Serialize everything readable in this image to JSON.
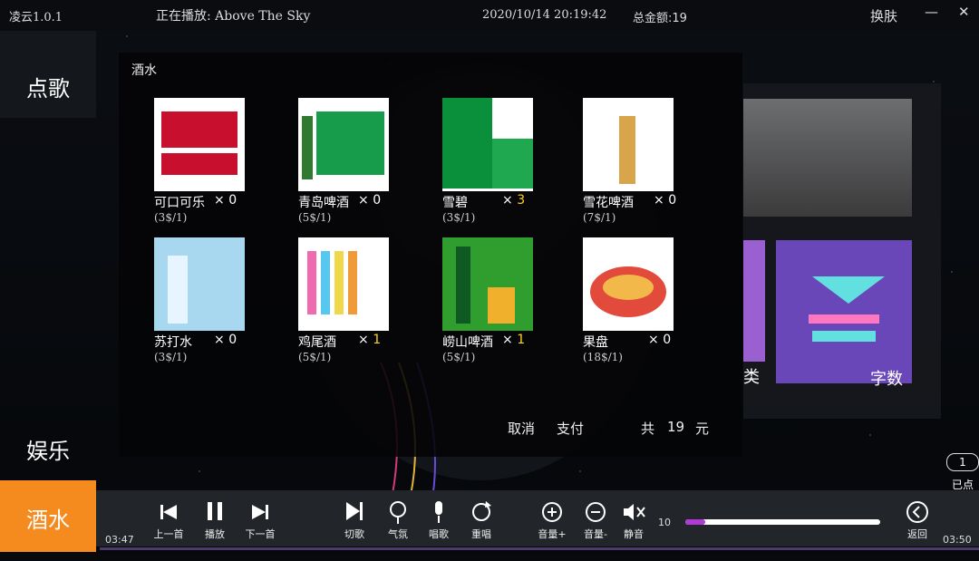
{
  "app": {
    "title": "凌云1.0.1",
    "now_playing": "正在播放: Above The Sky",
    "datetime": "2020/10/14 20:19:42",
    "total": "总金额:19",
    "skin": "换肤"
  },
  "window": {
    "min": "—",
    "close": "✕"
  },
  "sidebar": {
    "items": [
      {
        "label": "点歌"
      },
      {
        "label": "娱乐"
      },
      {
        "label": "酒水",
        "active": true
      }
    ]
  },
  "dialog": {
    "title": "酒水",
    "items": [
      {
        "name": "可口可乐",
        "count": "0",
        "price": "(3$/1)",
        "highlight": false
      },
      {
        "name": "青岛啤酒",
        "count": "0",
        "price": "(5$/1)",
        "highlight": false
      },
      {
        "name": "雪碧",
        "count": "3",
        "price": "(3$/1)",
        "highlight": true
      },
      {
        "name": "雪花啤酒",
        "count": "0",
        "price": "(7$/1)",
        "highlight": false
      },
      {
        "name": "苏打水",
        "count": "0",
        "price": "(3$/1)",
        "highlight": false
      },
      {
        "name": "鸡尾酒",
        "count": "1",
        "price": "(5$/1)",
        "highlight": true
      },
      {
        "name": "崂山啤酒",
        "count": "1",
        "price": "(5$/1)",
        "highlight": true
      },
      {
        "name": "果盘",
        "count": "0",
        "price": "(18$/1)",
        "highlight": false
      }
    ],
    "footer": {
      "cancel": "取消",
      "pay": "支付",
      "total_prefix": "共",
      "total_value": "19",
      "total_unit": "元"
    }
  },
  "right_panel": {
    "category": "类",
    "word_count": "字数"
  },
  "already": {
    "count": "1",
    "label": "已点"
  },
  "controls": {
    "prev": "上一首",
    "play": "播放",
    "next": "下一首",
    "cut": "切歌",
    "ambient": "气氛",
    "sing": "唱歌",
    "replay": "重唱",
    "vol_up": "音量+",
    "vol_down": "音量-",
    "mute": "静音",
    "volume": 10,
    "volume_label": "10",
    "back": "返回"
  },
  "time": {
    "elapsed": "03:47",
    "total": "03:50"
  },
  "colors": {
    "accent": "#f58a1f",
    "highlight": "#ffd21f",
    "volume": "#b03ad8"
  }
}
